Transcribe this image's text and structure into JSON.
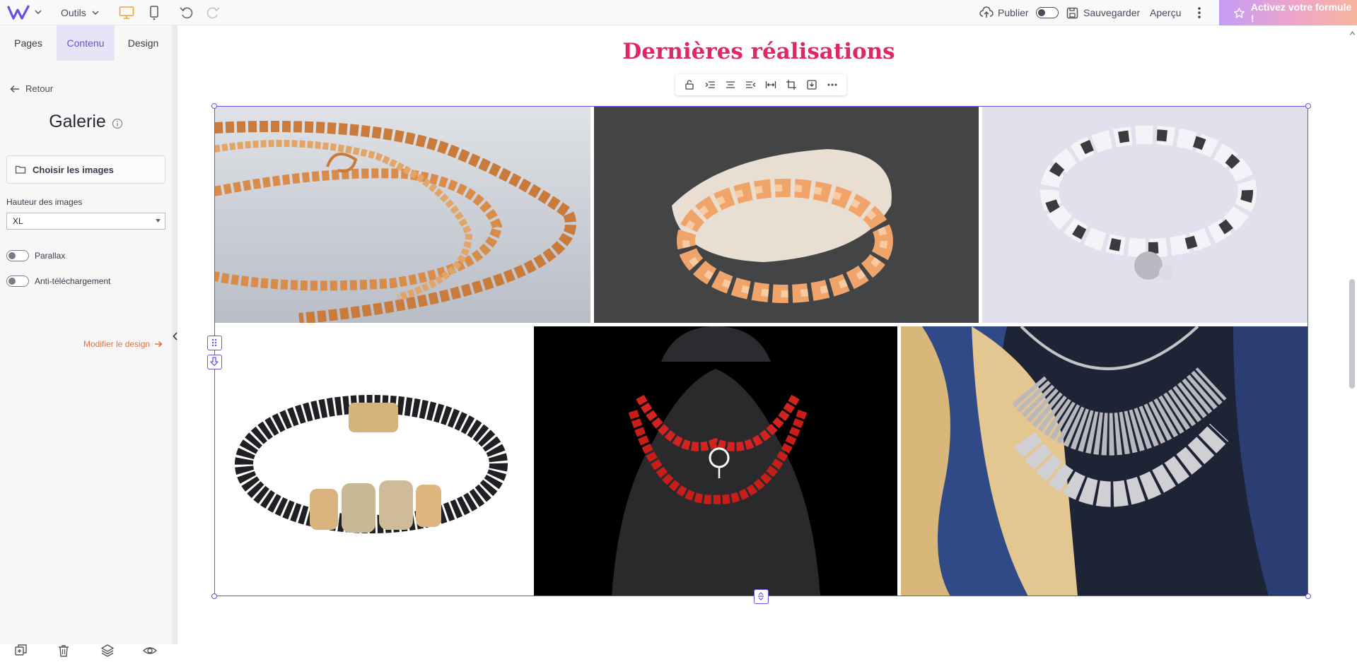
{
  "topbar": {
    "tools_label": "Outils",
    "publish_label": "Publier",
    "save_label": "Sauvegarder",
    "preview_label": "Aperçu",
    "upgrade_label": "Activez votre formule !"
  },
  "panel": {
    "tabs": [
      {
        "label": "Pages",
        "active": false
      },
      {
        "label": "Contenu",
        "active": true
      },
      {
        "label": "Design",
        "active": false
      }
    ],
    "back_label": "Retour",
    "title": "Galerie",
    "choose_images_label": "Choisir les images",
    "image_height_label": "Hauteur des images",
    "image_height_value": "XL",
    "toggles": [
      {
        "label": "Parallax",
        "on": false
      },
      {
        "label": "Anti-téléchargement",
        "on": false
      }
    ],
    "modify_design_label": "Modifier le design"
  },
  "canvas": {
    "section_title": "Dernières réalisations",
    "gallery_images": [
      {
        "name": "gold-chain-necklace"
      },
      {
        "name": "orange-bead-bracelet"
      },
      {
        "name": "silver-pearl-bracelet"
      },
      {
        "name": "black-leather-bracelet"
      },
      {
        "name": "red-bead-necklace"
      },
      {
        "name": "silver-coin-necklace"
      }
    ]
  },
  "colors": {
    "accent": "#6c4fe0",
    "title_pink": "#e0266a",
    "link_orange": "#e0733f",
    "device_orange": "#f0a23c"
  },
  "icons": [
    "logo-icon",
    "desktop-icon",
    "mobile-icon",
    "undo-icon",
    "redo-icon",
    "cloud-upload-icon",
    "save-icon",
    "kebab-icon",
    "star-icon",
    "back-arrow-icon",
    "info-icon",
    "folder-icon",
    "arrow-right-icon",
    "duplicate-icon",
    "trash-icon",
    "layers-icon",
    "eye-icon"
  ]
}
